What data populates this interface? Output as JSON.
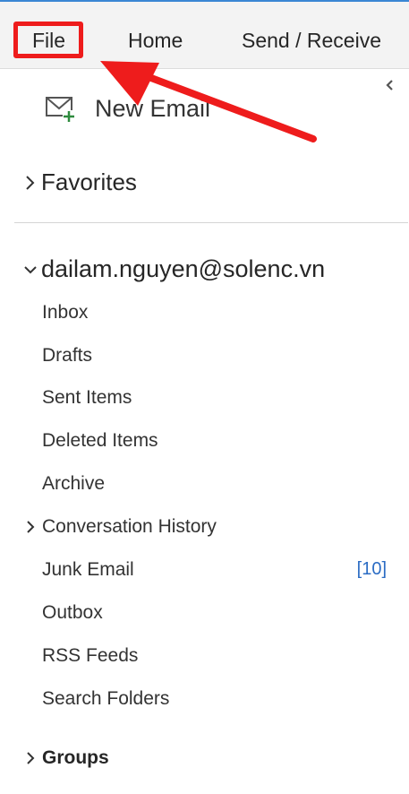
{
  "ribbon": {
    "tabs": [
      {
        "label": "File"
      },
      {
        "label": "Home"
      },
      {
        "label": "Send / Receive"
      }
    ]
  },
  "nav": {
    "new_email_label": "New Email",
    "favorites_label": "Favorites",
    "account": {
      "email": "dailam.nguyen@solenc.vn",
      "folders": [
        {
          "label": "Inbox"
        },
        {
          "label": "Drafts"
        },
        {
          "label": "Sent Items"
        },
        {
          "label": "Deleted Items"
        },
        {
          "label": "Archive"
        },
        {
          "label": "Conversation History"
        },
        {
          "label": "Junk Email",
          "badge": "[10]"
        },
        {
          "label": "Outbox"
        },
        {
          "label": "RSS Feeds"
        },
        {
          "label": "Search Folders"
        }
      ]
    },
    "groups_label": "Groups"
  },
  "colors": {
    "annotation_red": "#ee1c1c",
    "accent_blue": "#2b6cc4",
    "new_email_plus": "#2e8b3e"
  },
  "icons": {
    "new_email": "envelope-plus-icon",
    "collapse": "chevron-left-icon",
    "expand": "chevron-right-icon",
    "expanded": "chevron-down-icon"
  }
}
